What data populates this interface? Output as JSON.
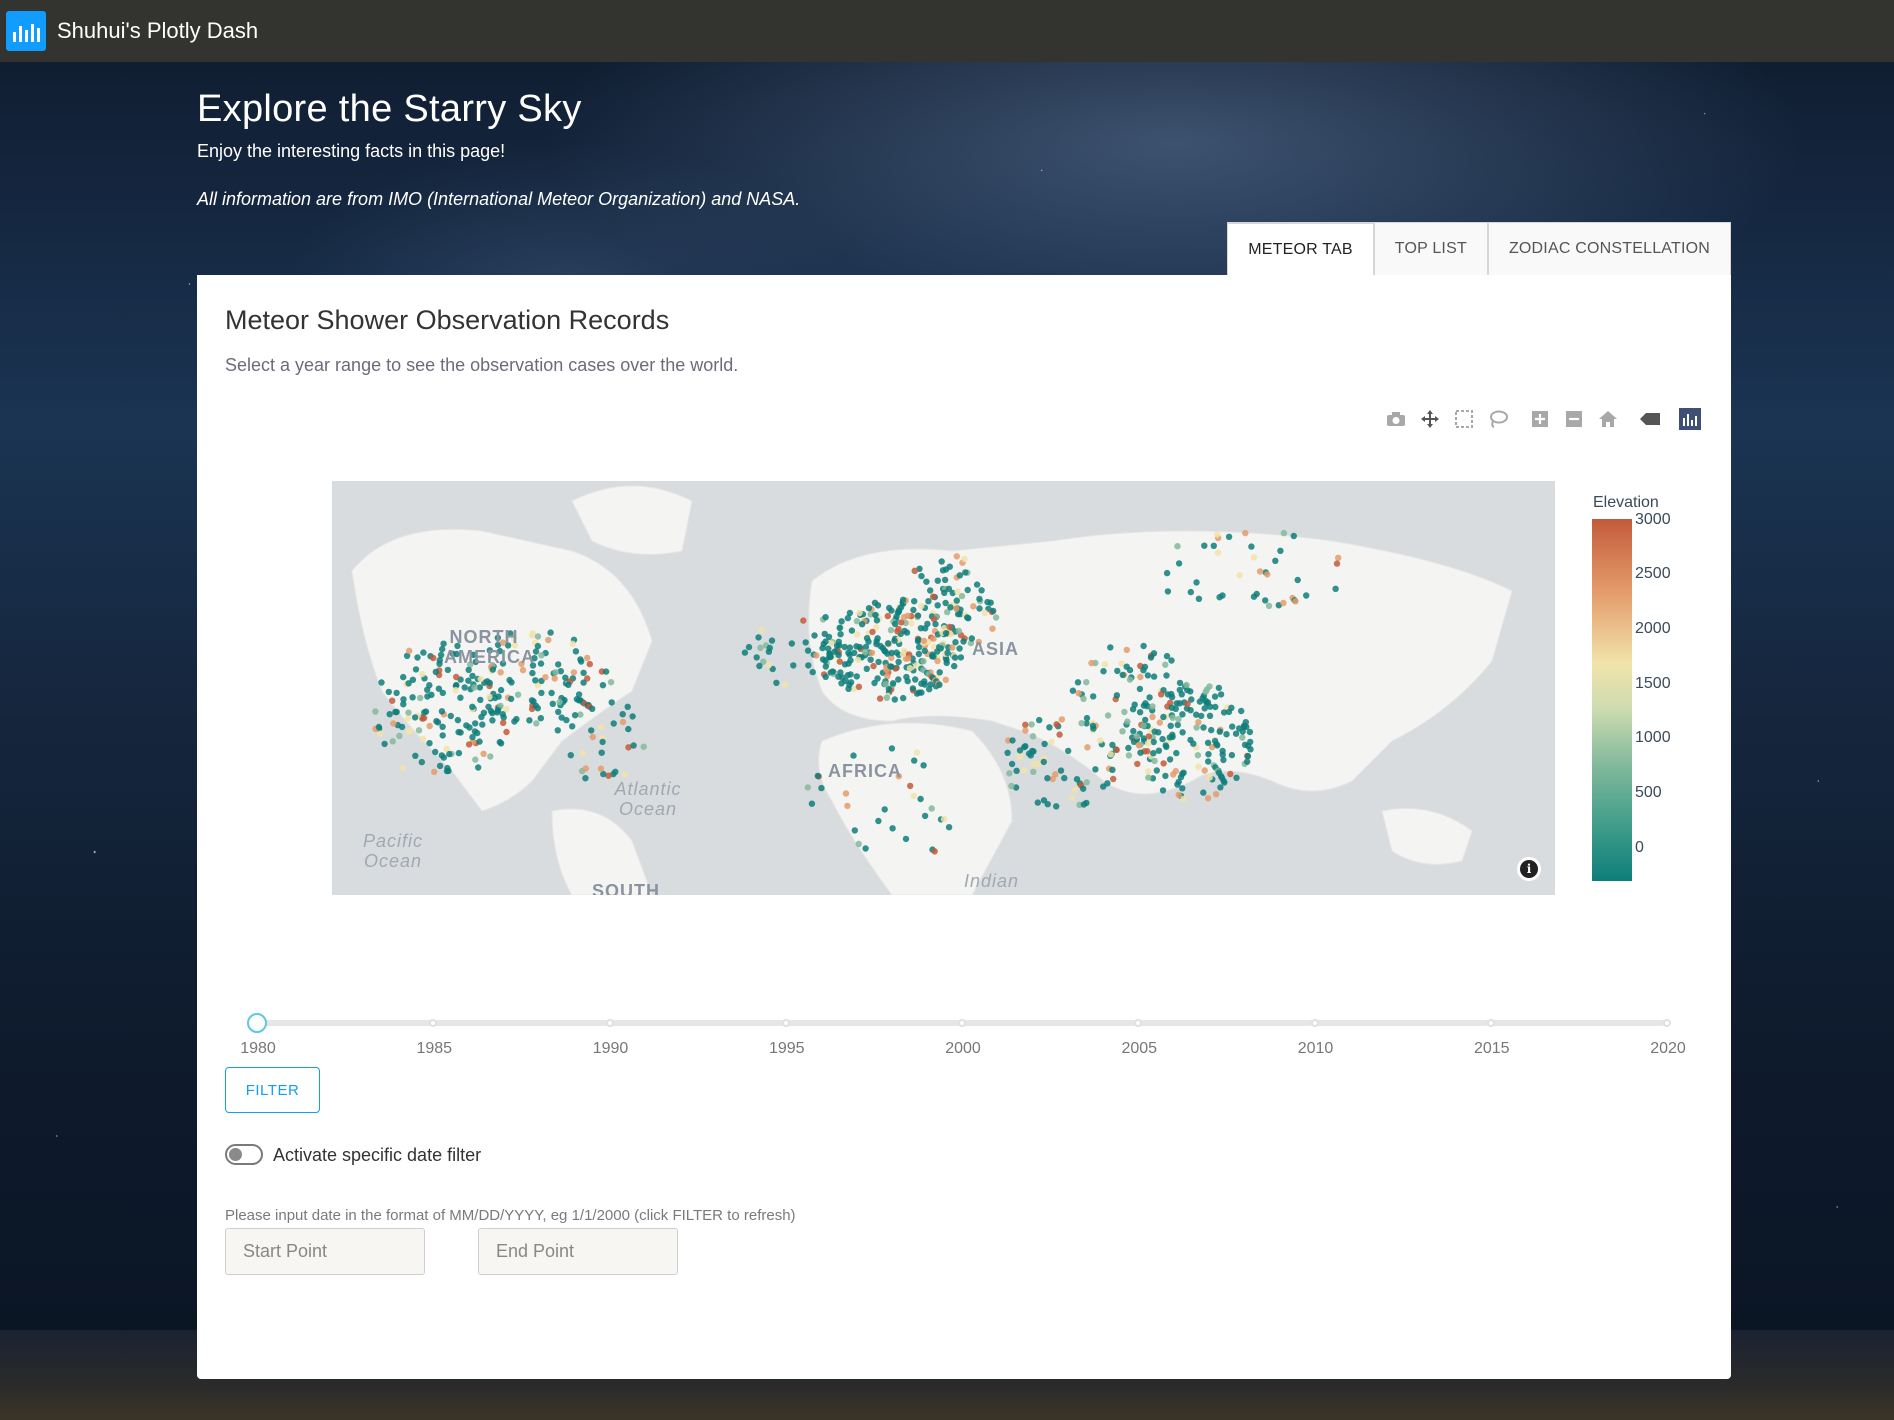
{
  "topbar": {
    "app_title": "Shuhui's Plotly Dash",
    "logo_icon": "plotly-dash-logo-icon",
    "accent": "#119dff"
  },
  "header": {
    "title": "Explore the Starry Sky",
    "subtitle": "Enjoy the interesting facts in this page!",
    "source_note": "All information are from IMO (International Meteor Organization) and NASA."
  },
  "tabs": [
    {
      "label": "METEOR TAB",
      "active": true
    },
    {
      "label": "TOP LIST",
      "active": false
    },
    {
      "label": "ZODIAC CONSTELLATION",
      "active": false
    }
  ],
  "panel": {
    "title": "Meteor Shower Observation Records",
    "description": "Select a year range to see the observation cases over the world."
  },
  "modebar": [
    "camera-icon",
    "pan-icon",
    "box-select-icon",
    "lasso-icon",
    "zoom-in-icon",
    "zoom-out-icon",
    "reset-home-icon",
    "hover-label-icon",
    "plotly-logo-icon"
  ],
  "map": {
    "labels": {
      "north_america": "NORTH AMERICA",
      "asia": "ASIA",
      "africa": "AFRICA",
      "atlantic": "Atlantic Ocean",
      "pacific": "Pacific Ocean",
      "indian": "Indian",
      "south": "SOUTH"
    },
    "colorbar": {
      "title": "Elevation",
      "ticks": [
        "3000",
        "2500",
        "2000",
        "1500",
        "1000",
        "500",
        "0"
      ],
      "colors": [
        "#c35b3b",
        "#e49b6b",
        "#f1e3aa",
        "#82b99c",
        "#0e7e7a"
      ]
    }
  },
  "slider": {
    "marks": [
      "1980",
      "1985",
      "1990",
      "1995",
      "2000",
      "2005",
      "2010",
      "2015",
      "2020"
    ],
    "selected": "1980"
  },
  "filter_button": {
    "label": "FILTER"
  },
  "toggle": {
    "label": "Activate specific date filter",
    "on": false
  },
  "date_filter": {
    "hint": "Please input date in the format of MM/DD/YYYY, eg 1/1/2000 (click FILTER to refresh)",
    "start_placeholder": "Start Point",
    "end_placeholder": "End Point"
  }
}
